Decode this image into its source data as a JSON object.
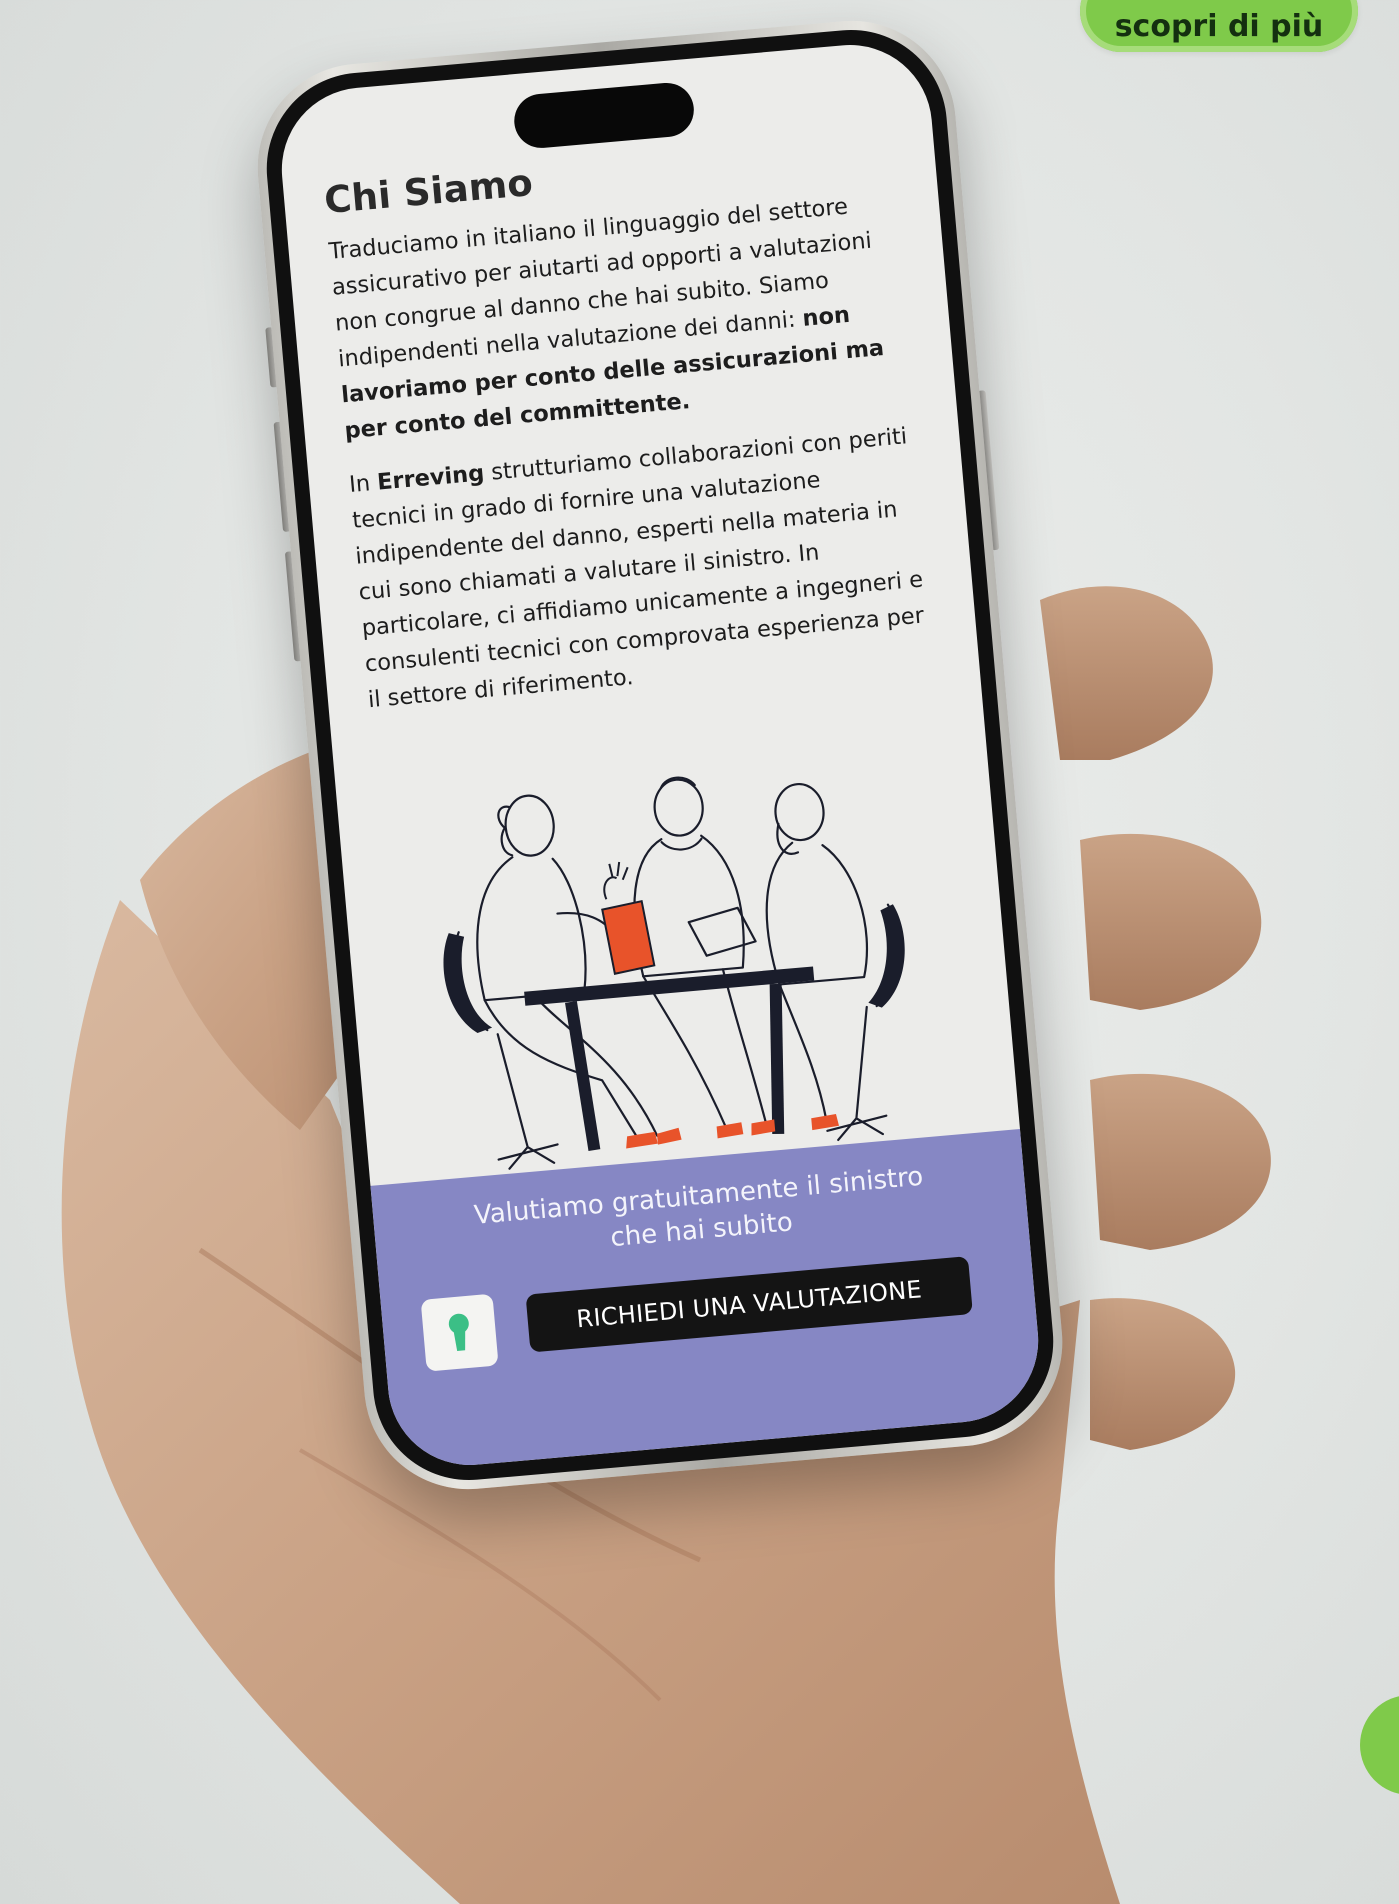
{
  "promo": {
    "cta_label": "scopri di più",
    "accent_color": "#7fca4a"
  },
  "screen": {
    "title": "Chi Siamo",
    "paragraph1": {
      "text_a": "Traduciamo in italiano il linguaggio del settore assicurativo per aiutarti ad opporti a valutazioni non congrue al danno che hai subito. Siamo indipendenti nella valutazione dei danni: ",
      "text_bold": "non lavoriamo per conto delle assicurazioni ma per conto del committente."
    },
    "paragraph2": {
      "text_a": "In ",
      "text_bold": "Erreving",
      "text_b": " strutturiamo collaborazioni con periti tecnici in grado di fornire una valutazione indipendente del danno, esperti nella materia in cui sono chiamati a valutare il sinistro. In particolare, ci affidiamo unicamente a ingegneri e consulenti tecnici con comprovata esperienza per il settore di riferimento."
    },
    "illustration_icon": "meeting-illustration",
    "footer": {
      "line1": "Valutiamo gratuitamente il sinistro",
      "line2": "che hai subito",
      "button_label": "RICHIEDI UNA VALUTAZIONE",
      "lock_icon": "keyhole-icon",
      "band_color": "#8687c4"
    }
  }
}
